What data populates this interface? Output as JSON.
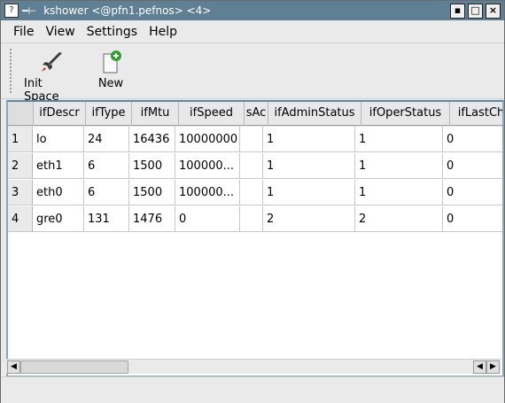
{
  "window": {
    "title": "kshower <@pfn1.pefnos> <4>"
  },
  "titlebar": {
    "minimize": "▪",
    "maximize": "□",
    "close": "×"
  },
  "menu": [
    {
      "label": "File"
    },
    {
      "label": "View"
    },
    {
      "label": "Settings"
    },
    {
      "label": "Help"
    }
  ],
  "toolbar": {
    "init_space_label": "Init Space",
    "new_label": "New"
  },
  "table": {
    "columns": [
      "ifDescr",
      "ifType",
      "ifMtu",
      "ifSpeed",
      "sAc",
      "ifAdminStatus",
      "ifOperStatus",
      "ifLastCh"
    ],
    "rows": [
      {
        "num": "1",
        "cells": [
          "lo",
          "24",
          "16436",
          "10000000",
          "",
          "1",
          "1",
          "0"
        ]
      },
      {
        "num": "2",
        "cells": [
          "eth1",
          "6",
          "1500",
          "100000...",
          "",
          "1",
          "1",
          "0"
        ]
      },
      {
        "num": "3",
        "cells": [
          "eth0",
          "6",
          "1500",
          "100000...",
          "",
          "1",
          "1",
          "0"
        ]
      },
      {
        "num": "4",
        "cells": [
          "gre0",
          "131",
          "1476",
          "0",
          "",
          "2",
          "2",
          "0"
        ]
      }
    ]
  },
  "scrollbar": {
    "left": "◀",
    "right": "▶"
  }
}
